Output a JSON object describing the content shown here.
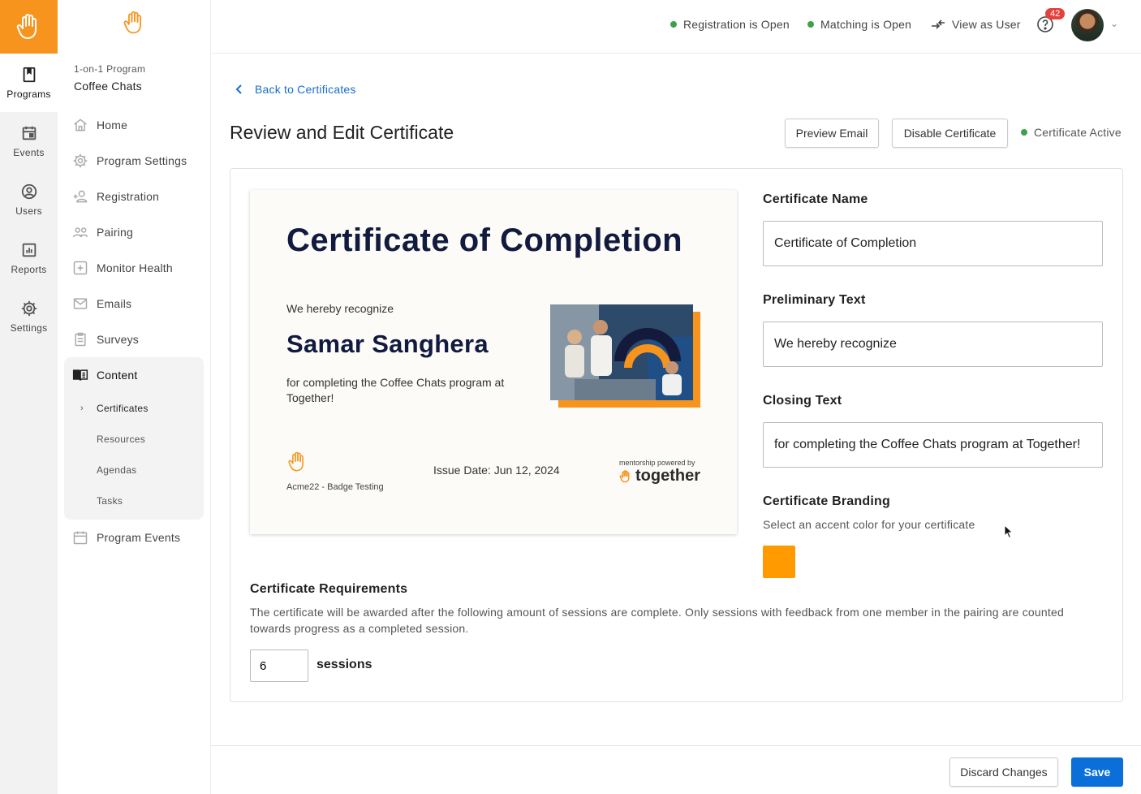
{
  "rail": {
    "items": [
      {
        "label": "Programs",
        "icon": "book-icon",
        "active": true
      },
      {
        "label": "Events",
        "icon": "calendar-icon"
      },
      {
        "label": "Users",
        "icon": "user-circle-icon"
      },
      {
        "label": "Reports",
        "icon": "chart-icon"
      },
      {
        "label": "Settings",
        "icon": "gear-icon"
      }
    ]
  },
  "sidebar": {
    "program_type": "1-on-1 Program",
    "program_name": "Coffee Chats",
    "items": [
      {
        "label": "Home",
        "icon": "home-icon"
      },
      {
        "label": "Program Settings",
        "icon": "gear-icon"
      },
      {
        "label": "Registration",
        "icon": "add-user-icon"
      },
      {
        "label": "Pairing",
        "icon": "pairing-icon"
      },
      {
        "label": "Monitor Health",
        "icon": "plus-box-icon"
      },
      {
        "label": "Emails",
        "icon": "mail-icon"
      },
      {
        "label": "Surveys",
        "icon": "clipboard-icon"
      },
      {
        "label": "Content",
        "icon": "open-book-icon"
      },
      {
        "label": "Program Events",
        "icon": "calendar-icon"
      }
    ],
    "content_sub": [
      "Certificates",
      "Resources",
      "Agendas",
      "Tasks"
    ]
  },
  "topbar": {
    "registration": "Registration is Open",
    "matching": "Matching is Open",
    "view_as_user": "View as User",
    "notification_count": "42"
  },
  "main": {
    "back_label": "Back to Certificates",
    "title": "Review and Edit Certificate",
    "preview_email": "Preview Email",
    "disable_certificate": "Disable Certificate",
    "status": "Certificate Active"
  },
  "certificate": {
    "title": "Certificate of Completion",
    "preliminary": "We hereby recognize",
    "recipient": "Samar Sanghera",
    "closing": "for completing the Coffee Chats program at Together!",
    "org": "Acme22 - Badge Testing",
    "issue_date": "Issue Date: Jun 12, 2024",
    "powered_by": "mentorship powered by",
    "brand": "together"
  },
  "form": {
    "name_label": "Certificate Name",
    "name_value": "Certificate of Completion",
    "prelim_label": "Preliminary Text",
    "prelim_value": "We hereby recognize",
    "closing_label": "Closing Text",
    "closing_value": "for completing the Coffee Chats program at Together!",
    "branding_label": "Certificate Branding",
    "branding_help": "Select an accent color for your certificate",
    "accent_color": "#ff9a00"
  },
  "requirements": {
    "title": "Certificate Requirements",
    "description": "The certificate will be awarded after the following amount of sessions are complete. Only sessions with feedback from one member in the pairing are counted towards progress as a completed session.",
    "sessions_value": "6",
    "sessions_unit": "sessions"
  },
  "footer": {
    "discard": "Discard Changes",
    "save": "Save"
  }
}
